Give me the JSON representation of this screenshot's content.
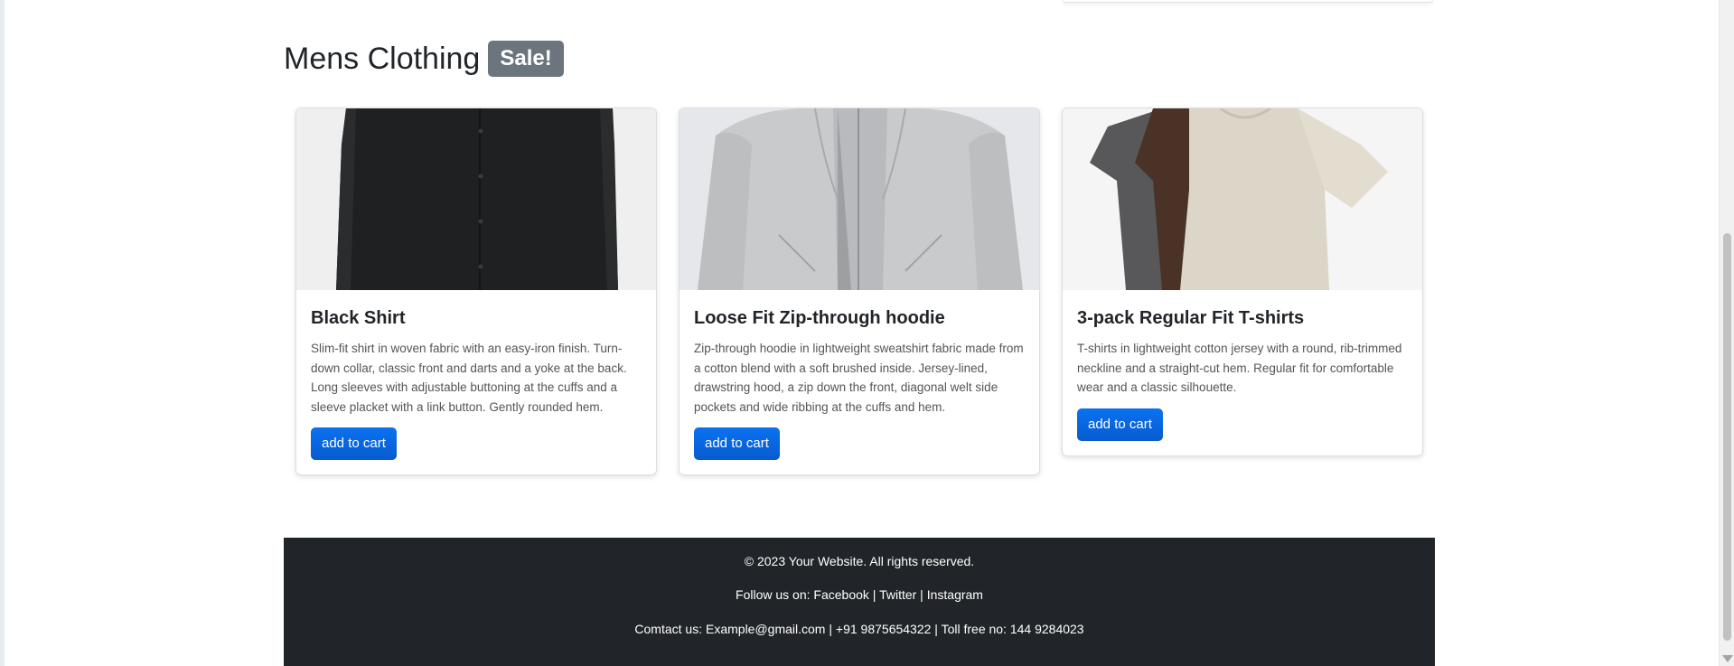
{
  "section": {
    "title": "Mens Clothing",
    "badge": "Sale!"
  },
  "products": [
    {
      "title": "Black Shirt",
      "description": "Slim-fit shirt in woven fabric with an easy-iron finish. Turn-down collar, classic front and darts and a yoke at the back. Long sleeves with adjustable buttoning at the cuffs and a sleeve placket with a link button. Gently rounded hem.",
      "button": "add to cart",
      "image_icon": "black-shirt-image"
    },
    {
      "title": "Loose Fit Zip-through hoodie",
      "description": "Zip-through hoodie in lightweight sweatshirt fabric made from a cotton blend with a soft brushed inside. Jersey-lined, drawstring hood, a zip down the front, diagonal welt side pockets and wide ribbing at the cuffs and hem.",
      "button": "add to cart",
      "image_icon": "grey-hoodie-image"
    },
    {
      "title": "3-pack Regular Fit T-shirts",
      "description": "T-shirts in lightweight cotton jersey with a round, rib-trimmed neckline and a straight-cut hem. Regular fit for comfortable wear and a classic silhouette.",
      "button": "add to cart",
      "image_icon": "tshirts-image"
    }
  ],
  "footer": {
    "copyright": "© 2023 Your Website. All rights reserved.",
    "follow_prefix": "Follow us on: ",
    "social": [
      "Facebook",
      "Twitter",
      "Instagram"
    ],
    "separator": " | ",
    "contact_prefix": "Comtact us: ",
    "email": "Example@gmail.com",
    "phone": "+91 9875654322",
    "tollfree": "Toll free no: 144 9284023"
  },
  "colors": {
    "badge": "#6c757d",
    "button": "#0b6ef0",
    "footer_bg": "#212529"
  }
}
